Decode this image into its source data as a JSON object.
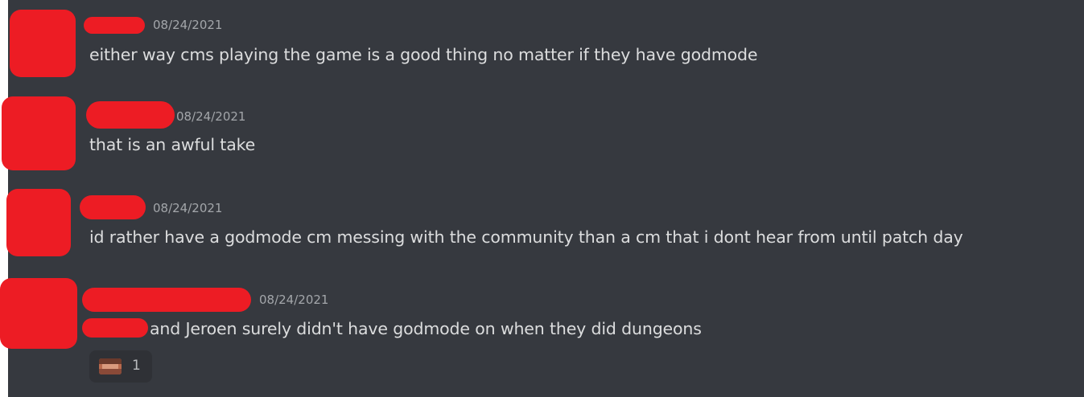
{
  "colors": {
    "background": "#36393f",
    "redaction": "#ed1c24",
    "text": "#dcddde",
    "timestamp": "#a3a6aa",
    "reaction_bg": "#2f3136"
  },
  "messages": [
    {
      "timestamp": "08/24/2021",
      "text": "either way cms playing the game is a good thing no matter if they have godmode"
    },
    {
      "timestamp": "08/24/2021",
      "text": "that is an awful take"
    },
    {
      "timestamp": "08/24/2021",
      "text": "id rather have a godmode cm messing with the community than a cm that i dont hear from until patch day"
    },
    {
      "timestamp": "08/24/2021",
      "text": "and Jeroen surely didn't have godmode on when they did dungeons",
      "reaction": {
        "emoji": "face-emoji-icon",
        "count": "1"
      }
    }
  ]
}
